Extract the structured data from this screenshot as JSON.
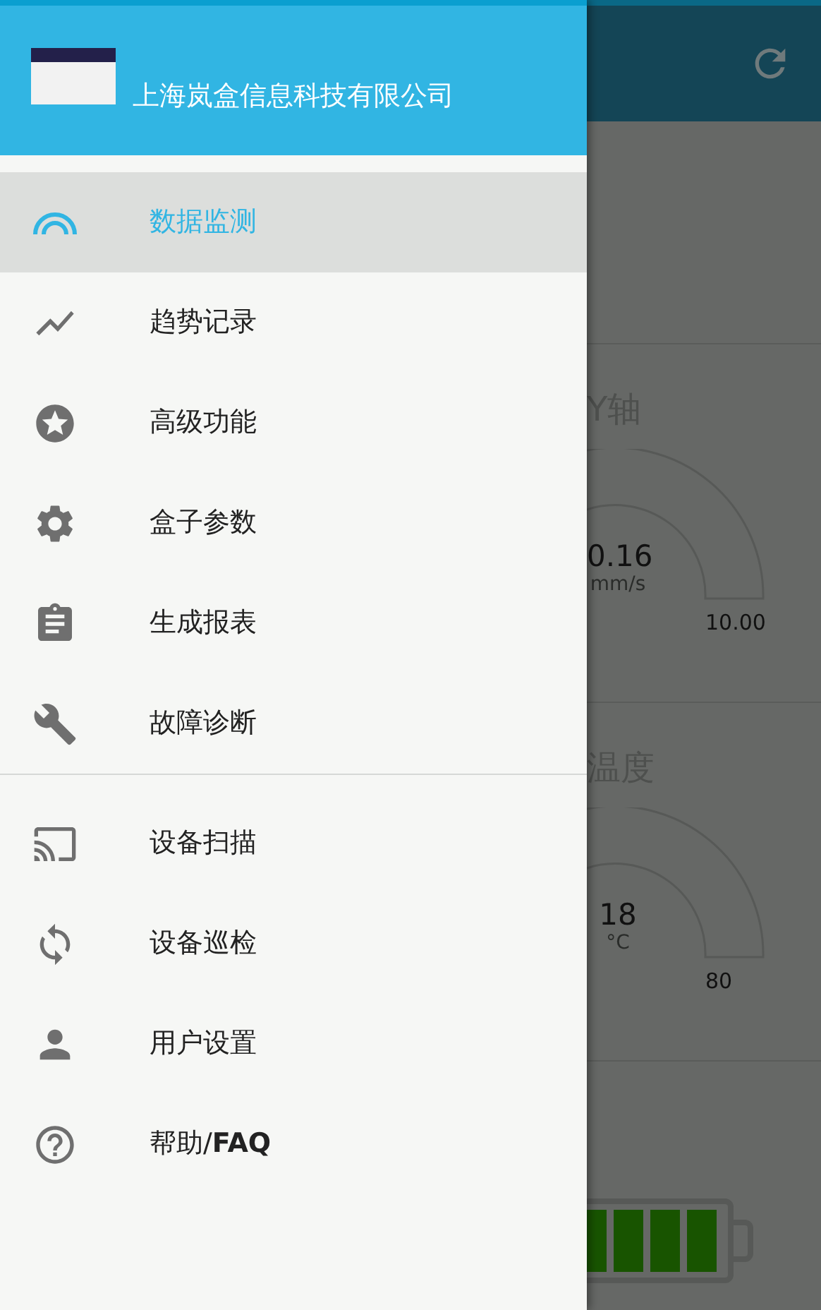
{
  "drawer": {
    "company": "上海岚盒信息科技有限公司",
    "groups": [
      [
        {
          "kind": "monitor",
          "label": "数据监测",
          "selected": true
        },
        {
          "kind": "trend",
          "label": "趋势记录",
          "selected": false
        },
        {
          "kind": "star",
          "label": "高级功能",
          "selected": false
        },
        {
          "kind": "gear",
          "label": "盒子参数",
          "selected": false
        },
        {
          "kind": "report",
          "label": "生成报表",
          "selected": false
        },
        {
          "kind": "wrench",
          "label": "故障诊断",
          "selected": false
        }
      ],
      [
        {
          "kind": "cast",
          "label": "设备扫描",
          "selected": false
        },
        {
          "kind": "sync",
          "label": "设备巡检",
          "selected": false
        },
        {
          "kind": "user",
          "label": "用户设置",
          "selected": false
        },
        {
          "kind": "help",
          "label": "帮助/**FAQ**",
          "selected": false
        }
      ]
    ]
  },
  "background": {
    "cards": [
      {
        "title": "Y轴",
        "value": "0.16",
        "unit": "mm/s",
        "max": "10.00"
      },
      {
        "title": "温度",
        "value": "18",
        "unit": "°C",
        "max": "80"
      }
    ]
  }
}
